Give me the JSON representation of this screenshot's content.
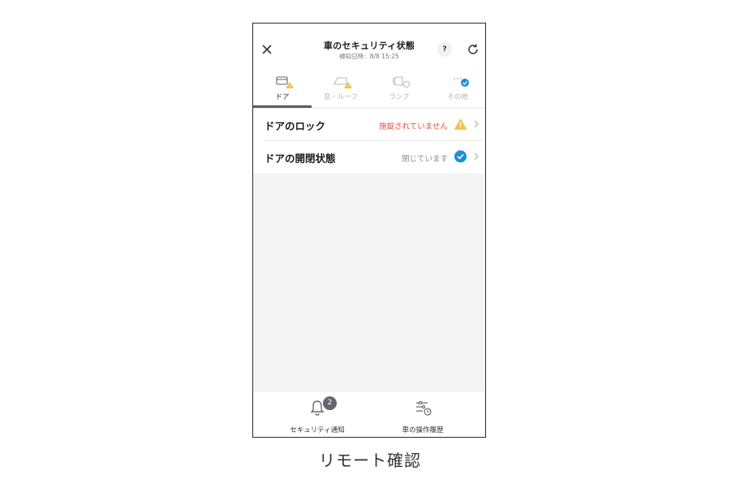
{
  "header": {
    "title": "車のセキュリティ状態",
    "subtitle": "検知日時：8/8 15:25",
    "help_label": "?"
  },
  "tabs": [
    {
      "label": "ドア",
      "active": true,
      "icon": "door-icon",
      "status": "warning"
    },
    {
      "label": "窓・ルーフ",
      "active": false,
      "icon": "window-icon",
      "status": "warning"
    },
    {
      "label": "ランプ",
      "active": false,
      "icon": "lamp-icon",
      "status": "ok"
    },
    {
      "label": "その他",
      "active": false,
      "icon": "more-icon",
      "status": "ok"
    }
  ],
  "rows": [
    {
      "label": "ドアのロック",
      "status": "施錠されていません",
      "status_color": "#e84c3d",
      "state": "warning"
    },
    {
      "label": "ドアの開閉状態",
      "status": "閉じています",
      "status_color": "#8a8a8a",
      "state": "ok"
    }
  ],
  "bottom_nav": [
    {
      "label": "セキュリティ通知",
      "icon": "bell-icon",
      "badge": "2"
    },
    {
      "label": "車の操作履歴",
      "icon": "history-icon"
    }
  ],
  "caption": "リモート確認",
  "colors": {
    "warning": "#f5c242",
    "ok": "#1a8fd6",
    "tab_underline": "#5c5c66"
  }
}
